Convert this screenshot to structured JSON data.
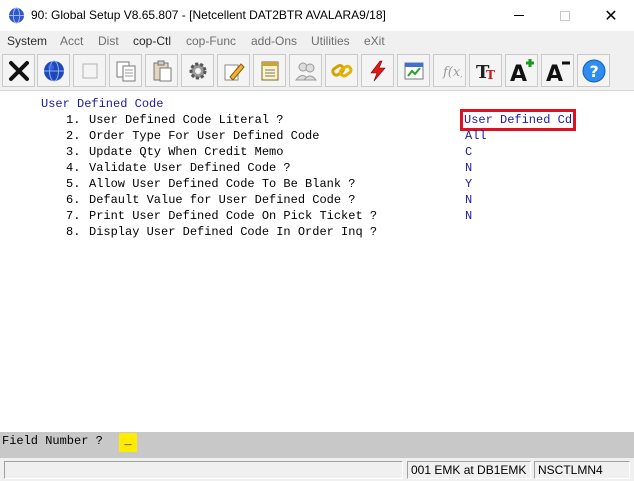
{
  "window": {
    "title": "90: Global Setup V8.65.807 - [Netcellent DAT2BTR AVALARA9/18]"
  },
  "menu": {
    "items": [
      {
        "label": "System"
      },
      {
        "label": "Acct"
      },
      {
        "label": "Dist"
      },
      {
        "label": "cop-Ctl"
      },
      {
        "label": "cop-Func"
      },
      {
        "label": "add-Ons"
      },
      {
        "label": "Utilities"
      },
      {
        "label": "eXit"
      }
    ]
  },
  "toolbar": {
    "buttons": [
      {
        "icon": "exit-x-icon"
      },
      {
        "icon": "globe-icon"
      },
      {
        "icon": "blank-icon"
      },
      {
        "icon": "copy-icon"
      },
      {
        "icon": "paste-icon"
      },
      {
        "icon": "settings-gear-icon"
      },
      {
        "icon": "edit-pencil-icon"
      },
      {
        "icon": "notepad-icon"
      },
      {
        "icon": "users-icon"
      },
      {
        "icon": "link-icon"
      },
      {
        "icon": "lightning-icon"
      },
      {
        "icon": "spreadsheet-icon"
      },
      {
        "icon": "function-icon"
      },
      {
        "icon": "font-icon"
      },
      {
        "icon": "font-increase-icon"
      },
      {
        "icon": "font-decrease-icon"
      },
      {
        "icon": "help-icon"
      }
    ],
    "font_up_label": "A",
    "font_down_label": "A",
    "font_label": "T"
  },
  "screen": {
    "heading": "User Defined Code",
    "fields": [
      {
        "num": "1.",
        "label": "User Defined Code Literal ?",
        "value": "User Defined Cd"
      },
      {
        "num": "2.",
        "label": "Order Type For User Defined Code",
        "value": "All"
      },
      {
        "num": "3.",
        "label": "Update Qty When Credit Memo",
        "value": "C"
      },
      {
        "num": "4.",
        "label": "Validate User Defined Code ?",
        "value": "N"
      },
      {
        "num": "5.",
        "label": "Allow User Defined Code To Be Blank ?",
        "value": "Y"
      },
      {
        "num": "6.",
        "label": "Default Value for User Defined Code ?",
        "value": "N"
      },
      {
        "num": "7.",
        "label": "Print User Defined Code On Pick Ticket ?",
        "value": "N"
      },
      {
        "num": "8.",
        "label": "Display User Defined Code In Order Inq ?",
        "value": ""
      }
    ],
    "prompt": "Field Number ?",
    "prompt_value": "_"
  },
  "status": {
    "panel1": "",
    "panel2": "001 EMK at DB1EMK",
    "panel3": "NSCTLMN4"
  }
}
